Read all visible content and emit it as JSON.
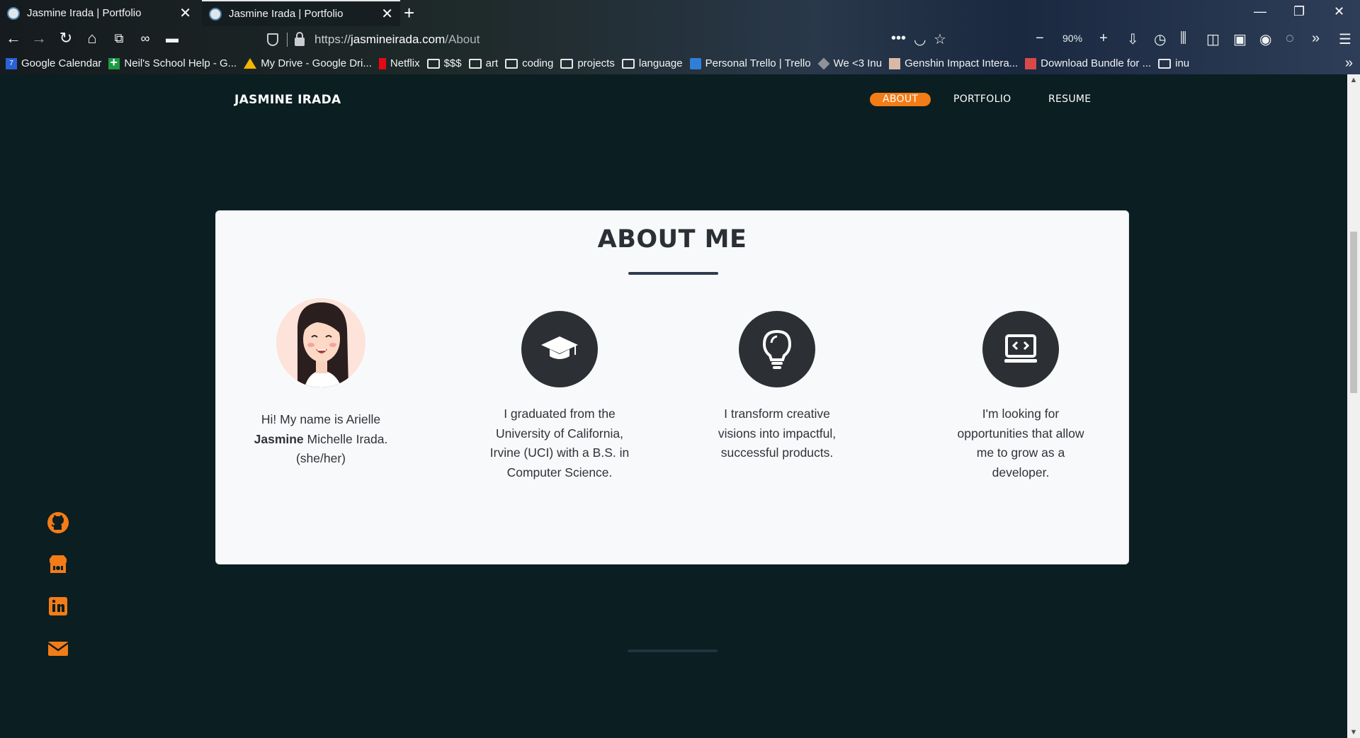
{
  "browser": {
    "tabs": [
      {
        "title": "Jasmine Irada | Portfolio",
        "active": false
      },
      {
        "title": "Jasmine Irada | Portfolio",
        "active": true
      }
    ],
    "url_scheme": "https://",
    "url_host": "jasmineirada.com",
    "url_path": "/About",
    "zoom": "90%",
    "bookmarks": [
      {
        "label": "Google Calendar",
        "icon": "calendar-icon"
      },
      {
        "label": "Neil's School Help - G...",
        "icon": "sheets-icon"
      },
      {
        "label": "My Drive - Google Dri...",
        "icon": "drive-icon"
      },
      {
        "label": "Netflix",
        "icon": "netflix-icon"
      },
      {
        "label": "$$$",
        "icon": "folder-icon"
      },
      {
        "label": "art",
        "icon": "folder-icon"
      },
      {
        "label": "coding",
        "icon": "folder-icon"
      },
      {
        "label": "projects",
        "icon": "folder-icon"
      },
      {
        "label": "language",
        "icon": "folder-icon"
      },
      {
        "label": "Personal Trello | Trello",
        "icon": "trello-icon"
      },
      {
        "label": "We <3 Inu",
        "icon": "cube-icon"
      },
      {
        "label": "Genshin Impact Intera...",
        "icon": "image-icon"
      },
      {
        "label": "Download Bundle for ...",
        "icon": "gift-icon"
      },
      {
        "label": "inu",
        "icon": "folder-icon"
      }
    ]
  },
  "site": {
    "brand": "JASMINE IRADA",
    "nav": {
      "about": "ABOUT",
      "portfolio": "PORTFOLIO",
      "resume": "RESUME"
    },
    "accent": "#f47c16",
    "background": "#0b1e22"
  },
  "about": {
    "title": "ABOUT ME",
    "intro_pre": "Hi! My name is Arielle",
    "intro_bold": "Jasmine",
    "intro_post": "Michelle Irada.",
    "intro_pronouns": "(she/her)",
    "education": "I graduated from the University of California, Irvine (UCI) with a B.S. in Computer Science.",
    "creative": "I transform creative visions into impactful, successful products.",
    "goals": "I'm looking for opportunities that allow me to grow as a developer."
  },
  "social": [
    "github-icon",
    "itchio-icon",
    "linkedin-icon",
    "email-icon"
  ]
}
